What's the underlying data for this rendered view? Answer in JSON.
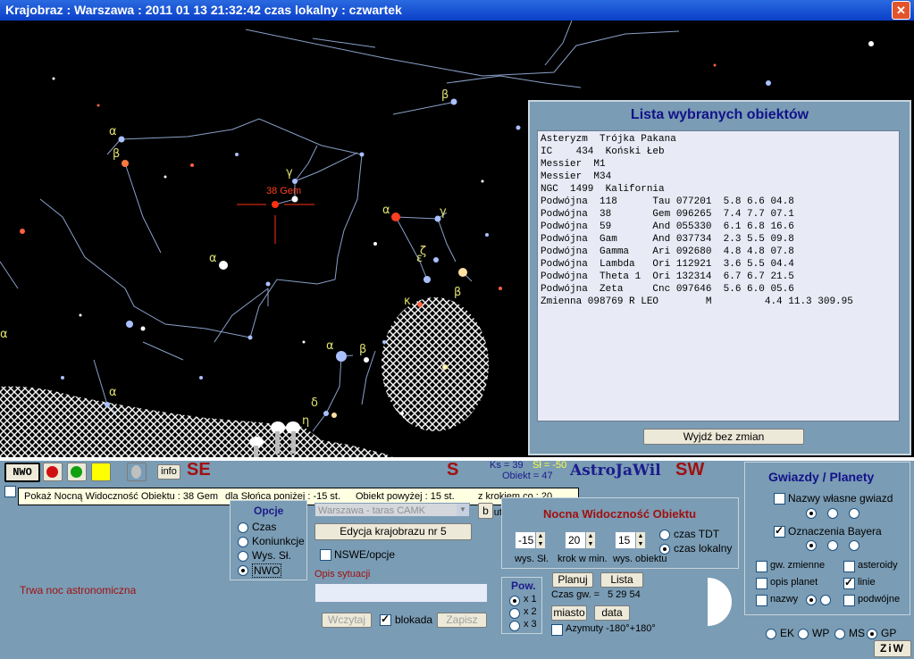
{
  "window": {
    "title": "Krajobraz  :  Warszawa  :  2011 01 13  21:32:42  czas lokalny  :  czwartek"
  },
  "sky": {
    "target_label": "38 Gem",
    "greek_labels": [
      "α",
      "β",
      "γ",
      "β",
      "α",
      "α",
      "ε",
      "γ",
      "κ",
      "β",
      "α",
      "β",
      "δ",
      "α",
      "α",
      "η",
      "α",
      "ζ",
      "ε"
    ]
  },
  "list_dialog": {
    "title": "Lista wybranych obiektów",
    "rows": [
      "Asteryzm  Trójka Pakana",
      "IC    434  Koński Łeb",
      "Messier  M1",
      "Messier  M34",
      "NGC  1499  Kalifornia",
      "Podwójna  118      Tau 077201  5.8 6.6 04.8",
      "Podwójna  38       Gem 096265  7.4 7.7 07.1",
      "Podwójna  59       And 055330  6.1 6.8 16.6",
      "Podwójna  Gam      And 037734  2.3 5.5 09.8",
      "Podwójna  Gamma    Ari 092680  4.8 4.8 07.8",
      "Podwójna  Lambda   Ori 112921  3.6 5.5 04.4",
      "Podwójna  Theta 1  Ori 132314  6.7 6.7 21.5",
      "Podwójna  Zeta     Cnc 097646  5.6 6.0 05.6",
      "Zmienna 098769 R LEO        M         4.4 11.3 309.95"
    ],
    "exit_button": "Wyjdź bez zmian"
  },
  "bottom": {
    "nwo_btn": "NWO",
    "info_btn": "info",
    "dir_se": "SE",
    "dir_s": "S",
    "dir_sw": "SW",
    "ks": "Ks = 39",
    "sf": "Sł = -50",
    "obiekt": "Obiekt = 47",
    "brand": "AstroJaWil",
    "tooltip": {
      "a": "Pokaż Nocną Widoczność Obiektu : 38 Gem",
      "b": "dla Słońca poniżej : -15 st.",
      "c": "Obiekt powyżej : 15 st.",
      "d": "z krokiem co : 20 minut"
    },
    "status": "Trwa noc astronomiczna"
  },
  "opcje": {
    "title": "Opcje",
    "items": [
      "Czas",
      "Koniunkcje",
      "Wys. Sł.",
      "NWO"
    ],
    "selected": 3
  },
  "krajobraz": {
    "select_value": "Warszawa - taras CAMK",
    "b_btn": "b",
    "edit_btn": "Edycja krajobrazu nr 5",
    "nswe_label": "NSWE/opcje",
    "opis_label": "Opis sytuacji",
    "opis_value": "",
    "wczytaj": "Wczytaj",
    "blokada": "blokada",
    "zapisz": "Zapisz"
  },
  "nwo_panel": {
    "title": "Nocna Widoczność Obiektu",
    "sun_alt": "-15",
    "step": "20",
    "obj_alt": "15",
    "tdt": "czas TDT",
    "local": "czas lokalny",
    "lbl_sun": "wys. Sł.",
    "lbl_step": "krok w min.",
    "lbl_obj": "wys. obiektu",
    "planuj": "Planuj",
    "lista": "Lista",
    "czas_gw_label": "Czas gw. =",
    "czas_gw_value": "5 29 54",
    "miasto": "miasto",
    "data": "data",
    "azymuty": "Azymuty -180°+180°"
  },
  "pow": {
    "title": "Pow.",
    "options": [
      "x 1",
      "x 2",
      "x 3"
    ]
  },
  "gwiazdy": {
    "title": "Gwiazdy / Planety",
    "nazwy_wlasne": "Nazwy własne gwiazd",
    "oznaczenia": "Oznaczenia Bayera",
    "gw_zmienne": "gw. zmienne",
    "asteroidy": "asteroidy",
    "opis_planet": "opis planet",
    "linie": "linie",
    "nazwy": "nazwy",
    "podwojne": "podwójne"
  },
  "coords": {
    "options": [
      "EK",
      "WP",
      "MS",
      "GP"
    ],
    "selected": 3,
    "ziw_btn": "ZiW"
  },
  "colors": {
    "sky": "#000000",
    "panel": "#7a9cb4",
    "dialog": "#7a9cb4",
    "listbg": "#e8ebf6",
    "accent_red": "#a01010",
    "brand_blue": "#1c1c8c"
  }
}
